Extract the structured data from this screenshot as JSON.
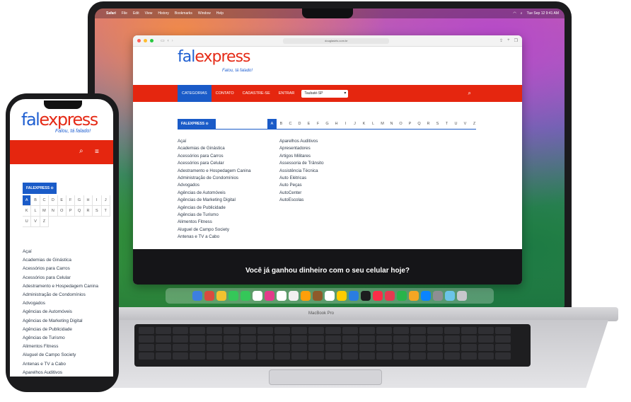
{
  "brand": {
    "fal": "fal",
    "exp": "express",
    "tagline": "Falou, tá falado!"
  },
  "mac": {
    "menu": [
      "Safari",
      "File",
      "Edit",
      "View",
      "History",
      "Bookmarks",
      "Window",
      "Help"
    ],
    "clock": "Tue Sep 12 9:41 AM",
    "url": "douglasirls.com.br",
    "model_label": "MacBook Pro",
    "dock_colors": [
      "#3d7fe0",
      "#d94b3f",
      "#f2c230",
      "#35c759",
      "#35c759",
      "#ffffff",
      "#e33c8b",
      "#ffffff",
      "#f0f0f0",
      "#ff9f0a",
      "#8e5a2a",
      "#ffffff",
      "#ffcc00",
      "#2a7de1",
      "#1c1c1e",
      "#fa2d48",
      "#e53a50",
      "#28b44a",
      "#f5a623",
      "#0a84ff",
      "#8e8e93",
      "#6bc4e8",
      "#c7c7cc"
    ]
  },
  "site": {
    "nav": [
      "CATEGORIAS",
      "CONTATO",
      "CADASTRE-SE",
      "ENTRAR"
    ],
    "select_value": "Taubaté-SP",
    "directory_tab": "FALEXPRESS ⊙",
    "alphabet": [
      "A",
      "B",
      "C",
      "D",
      "E",
      "F",
      "G",
      "H",
      "I",
      "J",
      "K",
      "L",
      "M",
      "N",
      "O",
      "P",
      "Q",
      "R",
      "S",
      "T",
      "U",
      "V",
      "Z"
    ],
    "col1": [
      "Açaí",
      "Academias de Ginástica",
      "Acessórios para Carros",
      "Acessórios para Celular",
      "Adestramento e Hospedagem Canina",
      "Administração de Condomínios",
      "Advogados",
      "Agências de Automóveis",
      "Agências de Marketing Digital",
      "Agências de Publicidade",
      "Agências de Turismo",
      "Alimentos Fitness",
      "Aluguel de Campo Society",
      "Antenas e TV a Cabo"
    ],
    "col2": [
      "Aparelhos Auditivos",
      "Apresentadores",
      "Artigos Militares",
      "Assessoria de Trânsito",
      "Assistência Técnica",
      "Auto Elétricas",
      "Auto Peças",
      "AutoCenter",
      "AutoEscolas"
    ],
    "footer_text": "Você já ganhou dinheiro com o seu celular hoje?"
  },
  "phone": {
    "directory_tab": "FALEXPRESS ⊙",
    "alphabet": [
      "A",
      "B",
      "C",
      "D",
      "E",
      "F",
      "G",
      "H",
      "I",
      "J",
      "K",
      "L",
      "M",
      "N",
      "O",
      "P",
      "Q",
      "R",
      "S",
      "T",
      "U",
      "V",
      "Z"
    ],
    "list": [
      "Açaí",
      "Academias de Ginástica",
      "Acessórios para Carros",
      "Acessórios para Celular",
      "Adestramento e Hospedagem Canina",
      "Administração de Condomínios",
      "Advogados",
      "Agências de Automóveis",
      "Agências de Marketing Digital",
      "Agências de Publicidade",
      "Agências de Turismo",
      "Alimentos Fitness",
      "Aluguel de Campo Society",
      "Antenas e TV a Cabo",
      "Aparelhos Auditivos"
    ]
  }
}
